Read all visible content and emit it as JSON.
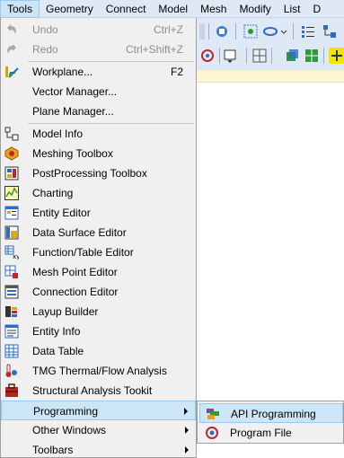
{
  "menubar": {
    "items": [
      "Tools",
      "Geometry",
      "Connect",
      "Model",
      "Mesh",
      "Modify",
      "List",
      "D"
    ]
  },
  "tools_menu": {
    "items": [
      {
        "label": "Undo",
        "shortcut": "Ctrl+Z",
        "icon": "undo-icon",
        "disabled": true
      },
      {
        "label": "Redo",
        "shortcut": "Ctrl+Shift+Z",
        "icon": "redo-icon",
        "disabled": true
      },
      {
        "label": "Workplane...",
        "shortcut": "F2",
        "icon": "workplane-icon"
      },
      {
        "label": "Vector Manager...",
        "shortcut": "",
        "icon": ""
      },
      {
        "label": "Plane Manager...",
        "shortcut": "",
        "icon": ""
      },
      {
        "label": "Model Info",
        "shortcut": "",
        "icon": "model-info-icon"
      },
      {
        "label": "Meshing Toolbox",
        "shortcut": "",
        "icon": "meshing-toolbox-icon"
      },
      {
        "label": "PostProcessing Toolbox",
        "shortcut": "",
        "icon": "postprocessing-toolbox-icon"
      },
      {
        "label": "Charting",
        "shortcut": "",
        "icon": "charting-icon"
      },
      {
        "label": "Entity Editor",
        "shortcut": "",
        "icon": "entity-editor-icon"
      },
      {
        "label": "Data Surface Editor",
        "shortcut": "",
        "icon": "data-surface-editor-icon"
      },
      {
        "label": "Function/Table Editor",
        "shortcut": "",
        "icon": "function-table-editor-icon"
      },
      {
        "label": "Mesh Point Editor",
        "shortcut": "",
        "icon": "mesh-point-editor-icon"
      },
      {
        "label": "Connection Editor",
        "shortcut": "",
        "icon": "connection-editor-icon"
      },
      {
        "label": "Layup Builder",
        "shortcut": "",
        "icon": "layup-builder-icon"
      },
      {
        "label": "Entity Info",
        "shortcut": "",
        "icon": "entity-info-icon"
      },
      {
        "label": "Data Table",
        "shortcut": "",
        "icon": "data-table-icon"
      },
      {
        "label": "TMG Thermal/Flow Analysis",
        "shortcut": "",
        "icon": "tmg-thermal-icon"
      },
      {
        "label": "Structural Analysis Tookit",
        "shortcut": "",
        "icon": "structural-toolkit-icon"
      },
      {
        "label": "Programming",
        "shortcut": "",
        "icon": "",
        "submenu": true,
        "highlighted": true
      },
      {
        "label": "Other Windows",
        "shortcut": "",
        "icon": "",
        "submenu": true
      },
      {
        "label": "Toolbars",
        "shortcut": "",
        "icon": "",
        "submenu": true
      }
    ]
  },
  "programming_submenu": {
    "items": [
      {
        "label": "API Programming",
        "icon": "api-programming-icon",
        "highlighted": true
      },
      {
        "label": "Program File",
        "icon": "program-file-icon"
      }
    ]
  },
  "colors": {
    "menubar_bg": "#dfe9f5",
    "menu_bg": "#f0f0f0",
    "highlight_bg": "#cde6f7",
    "highlight_border": "#99c9ef",
    "disabled_text": "#8d8d8d"
  }
}
